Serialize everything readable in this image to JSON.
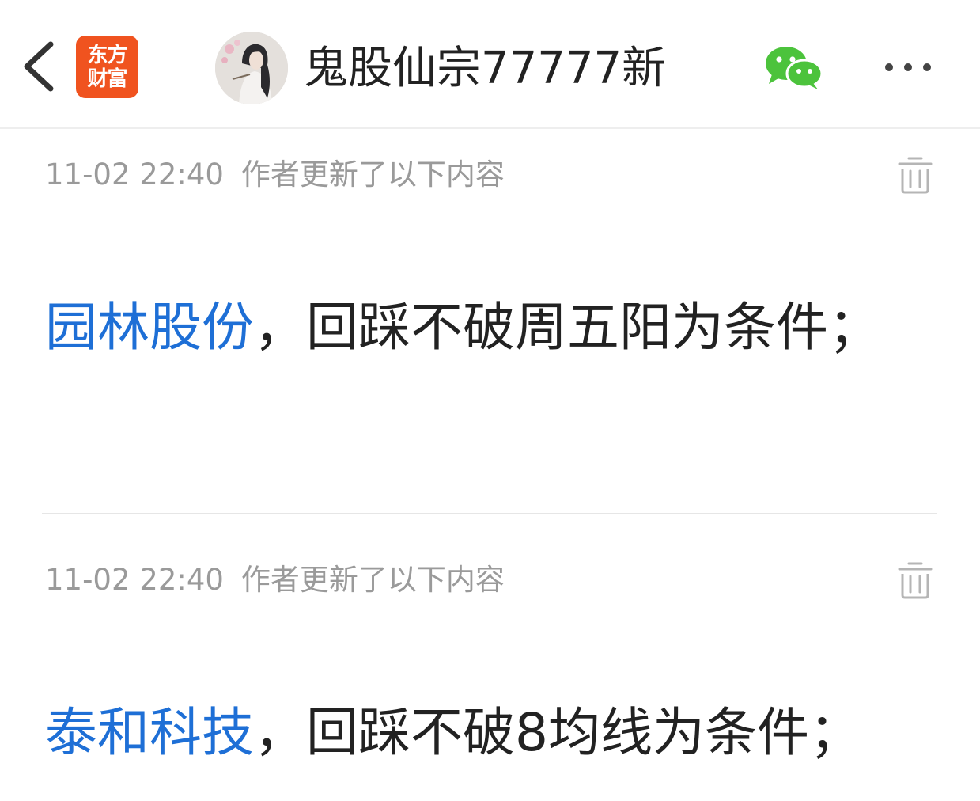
{
  "header": {
    "logo_line1": "东方",
    "logo_line2": "财富",
    "author_name": "鬼股仙宗77777新",
    "back_icon": "chevron-left-icon",
    "share_icon": "wechat-icon",
    "more_icon": "more-dots-icon"
  },
  "colors": {
    "brand": "#f0531f",
    "link": "#1e6fd6",
    "wechat": "#4cc33c",
    "meta_text": "#9a9a9a"
  },
  "updates": [
    {
      "timestamp": "11-02 22:40",
      "meta_label": "作者更新了以下内容",
      "stock": "园林股份",
      "content": "，回踩不破周五阳为条件；"
    },
    {
      "timestamp": "11-02 22:40",
      "meta_label": "作者更新了以下内容",
      "stock": "泰和科技",
      "content": "，回踩不破8均线为条件；"
    }
  ]
}
